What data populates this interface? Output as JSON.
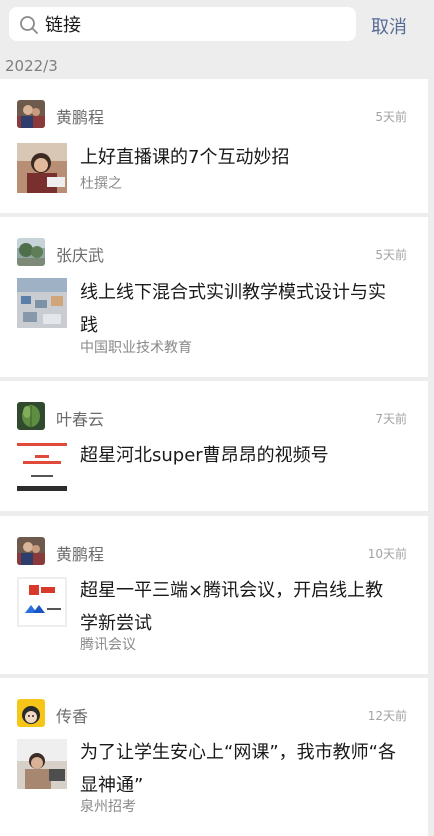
{
  "search": {
    "value": "链接",
    "cancel_label": "取消"
  },
  "date_header": "2022/3",
  "results": [
    {
      "sender": "黄鹏程",
      "time": "5天前",
      "title": "上好直播课的7个互动妙招",
      "source": "杜撰之"
    },
    {
      "sender": "张庆武",
      "time": "5天前",
      "title": "线上线下混合式实训教学模式设计与实践",
      "source": "中国职业技术教育"
    },
    {
      "sender": "叶春云",
      "time": "7天前",
      "title": "超星河北super曹昂昂的视频号",
      "source": ""
    },
    {
      "sender": "黄鹏程",
      "time": "10天前",
      "title": "超星一平三端×腾讯会议，开启线上教学新尝试",
      "source": "腾讯会议"
    },
    {
      "sender": "传香",
      "time": "12天前",
      "title": "为了让学生安心上“网课”，我市教师“各显神通”",
      "source": "泉州招考"
    }
  ],
  "icons": {
    "search": "search-icon",
    "avatars": [
      "avatar-photo",
      "avatar-landscape",
      "avatar-leaf",
      "avatar-photo",
      "avatar-cartoon"
    ],
    "thumbnails": [
      "thumb-person",
      "thumb-classroom",
      "thumb-slide",
      "thumb-logo",
      "thumb-person"
    ]
  },
  "colors": {
    "background": "#ededed",
    "card": "#ffffff",
    "link": "#576b95",
    "meta": "#a3a3a3"
  }
}
